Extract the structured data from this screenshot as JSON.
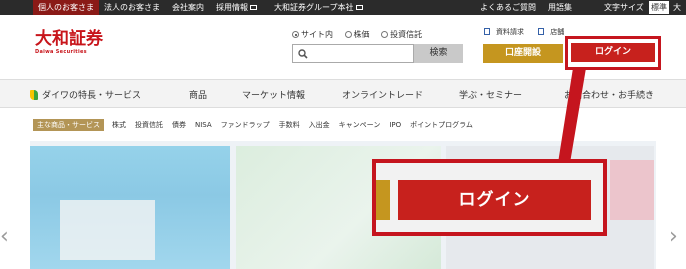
{
  "topbar": {
    "tab_individual": "個人のお客さま",
    "tab_corporate": "法人のお客さま",
    "company": "会社案内",
    "recruit": "採用情報",
    "group": "大和証券グループ本社",
    "faq": "よくあるご質問",
    "glossary": "用語集",
    "font_size_label": "文字サイズ",
    "font_std": "標準",
    "font_large": "大"
  },
  "logo": {
    "main": "大和証券",
    "sub": "Daiwa Securities"
  },
  "search": {
    "scopes": [
      "サイト内",
      "株価",
      "投資信託"
    ],
    "selected": "サイト内",
    "value": "",
    "button": "検索"
  },
  "header_links": {
    "documents": "資料請求",
    "stores": "店舗"
  },
  "buttons": {
    "open_account": "口座開設",
    "login": "ログイン"
  },
  "nav": [
    "ダイワの特長・サービス",
    "商品",
    "マーケット情報",
    "オンライントレード",
    "学ぶ・セミナー",
    "お問合わせ・お手続き"
  ],
  "subnav": {
    "tag": "主な商品・サービス",
    "links": [
      "株式",
      "投資信託",
      "債券",
      "NISA",
      "ファンドラップ",
      "手数料",
      "入出金",
      "キャンペーン",
      "IPO",
      "ポイントプログラム"
    ]
  },
  "zoom": {
    "login": "ログイン"
  },
  "colors": {
    "brand_red": "#c7211d",
    "gold": "#c5961f",
    "topbar": "#2b2b2b"
  }
}
